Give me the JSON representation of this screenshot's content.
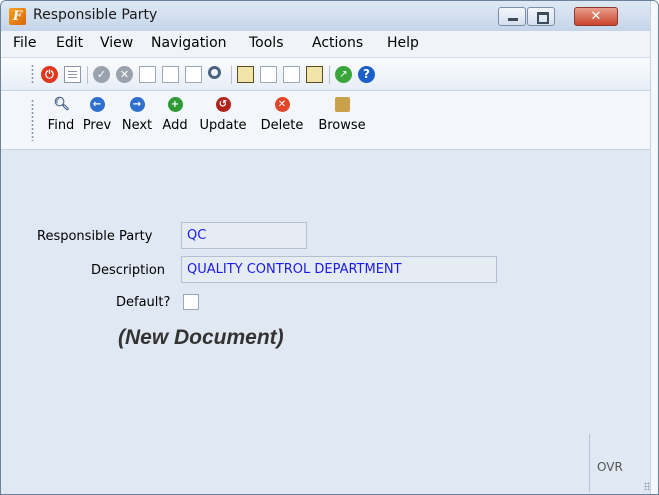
{
  "window": {
    "title": "Responsible Party",
    "close_glyph": "✕"
  },
  "menu": [
    "File",
    "Edit",
    "View",
    "Navigation",
    "Tools",
    "Actions",
    "Help"
  ],
  "toolbar_icons": [
    "power-icon",
    "print-icon",
    "check-icon",
    "cancel-icon",
    "copy-icon",
    "paste-icon",
    "select-icon",
    "zoom-icon",
    "notepad-icon",
    "attach-icon",
    "user-doc-icon",
    "calendar-icon",
    "chart-icon",
    "help-icon"
  ],
  "nav_buttons": [
    {
      "label": "Find",
      "icon": "search-icon"
    },
    {
      "label": "Prev",
      "icon": "arrow-left-icon"
    },
    {
      "label": "Next",
      "icon": "arrow-right-icon"
    },
    {
      "label": "Add",
      "icon": "plus-icon"
    },
    {
      "label": "Update",
      "icon": "refresh-icon"
    },
    {
      "label": "Delete",
      "icon": "delete-icon"
    },
    {
      "label": "Browse",
      "icon": "folder-icon"
    }
  ],
  "form": {
    "party_label": "Responsible Party",
    "party_value": "QC",
    "description_label": "Description",
    "description_value": "QUALITY CONTROL DEPARTMENT",
    "default_label": "Default?",
    "default_checked": false,
    "status_text": "(New Document)"
  },
  "statusbar": {
    "ovr": "OVR"
  }
}
